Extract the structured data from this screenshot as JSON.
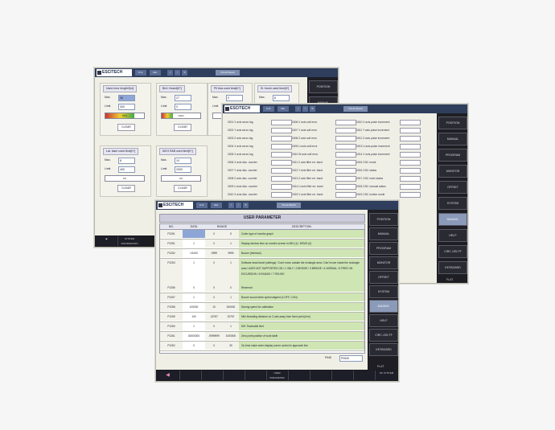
{
  "brand": "ESCITECH",
  "toolbar_tabs": [
    "U.S.",
    "Rel."
  ],
  "toolbar_wide_label": "Check Board",
  "toolbar_icons": [
    "info-icon",
    "alarm-icon",
    "edit-icon"
  ],
  "window_back": {
    "groups": [
      {
        "title": "Used error lengthX[m]",
        "max_label": "Max.",
        "max_value": "36",
        "limit_label": "Limit",
        "limit_value": "300",
        "progress_percent": 75,
        "progress_text": "75%",
        "button": "CLEAR"
      },
      {
        "title": "Bin1 Hosed[K*]",
        "max_label": "Max.",
        "max_value": "27",
        "limit_label": "Limit",
        "limit_value": "0",
        "progress_percent": 30,
        "progress_text": "100%",
        "button": "CLEAR"
      },
      {
        "title": "Pil bios used time[h*]",
        "max_label": "Max.",
        "max_value": "0",
        "limit_label": "Limit",
        "limit_value": "",
        "progress_percent": 0,
        "progress_text": "",
        "button": "CLEAR"
      },
      {
        "title": "Sl. brush used time[h*]",
        "max_label": "Max.",
        "max_value": "8",
        "limit_label": "Limit",
        "limit_value": "",
        "progress_percent": 0,
        "progress_text": "",
        "button": ""
      },
      {
        "title": "Lat. laser used time[h*]",
        "max_label": "Max.",
        "max_value": "8",
        "limit_label": "Limit",
        "limit_value": "400",
        "progress_percent": 0,
        "progress_text": "0%",
        "button": "CLEAR"
      },
      {
        "title": "MCH R&B used time[h*]",
        "max_label": "Max.",
        "max_value": "10",
        "limit_label": "Limit",
        "limit_value": "2000",
        "progress_percent": 0,
        "progress_text": "0%",
        "button": "CLEAR"
      }
    ],
    "sidebar": [
      "POSITION",
      "MANUAL"
    ],
    "bottom_slots": [
      "",
      "SYSTEM INFORMATION",
      "",
      "",
      "",
      "",
      "",
      "",
      ""
    ]
  },
  "window_mid": {
    "diag_columns": [
      [
        "0001 X axis servo lag",
        "0002 Y axis servo lag",
        "0003 Z axis servo lag",
        "0004 X axis servo lag",
        "0005 X axis servo lag",
        "0006 X axis disc. counter",
        "0007 Y axis disc. counter",
        "0008 Z axis disc. counter",
        "0009 U axis disc. counter",
        "0010 X axis disc. counter"
      ],
      [
        "0006 X axis soft error",
        "0007 Y axis soft error",
        "0008 Z axis soft error",
        "0009 U axis soft error",
        "0010 W axis soft error",
        "0011 X axis filter err. band",
        "0012 Y axis filter err. band",
        "0013 Z axis filter err. band",
        "0014 U axis filter err. band",
        "0015 V axis filter err. band"
      ],
      [
        "0010 X axis pulse increment",
        "0011 Y axis pulse increment",
        "0012 Z axis pulse increment",
        "0013 U axis pulse increment",
        "0014 V axis pulse increment",
        "0015 CNC mode",
        "0016 CNC status",
        "0017 CNC main status",
        "0018 CNC manual status",
        "0019 CNC motion mode"
      ]
    ],
    "sidebar": [
      "POSITION",
      "MANUAL",
      "PROGRAM",
      "MONITOR",
      "OFFSET",
      "SYSTEM",
      "DIAGNO.",
      "HELP",
      "CIRC LEN TF",
      "KEYBOARD"
    ],
    "sidebar_active_index": 6,
    "bottom_extra": "FLAT"
  },
  "window_front": {
    "title": "USER PARAMETER",
    "columns": [
      "NO.",
      "DATA",
      "RANGE",
      "",
      "DESCRIPTION"
    ],
    "rows": [
      {
        "no": "P1251",
        "data": "",
        "min": "0",
        "max": "5",
        "desc": "Cutter type of monitor graph",
        "selected": true
      },
      {
        "no": "P1251",
        "data": "1",
        "min": "0",
        "max": "1",
        "desc": "Display window time on monitor screen in MDI (1) / DEMO (0)"
      },
      {
        "no": "P1252",
        "data": "1/1000",
        "min": "-9999",
        "max": "9999",
        "desc": "Buzzer (interlock)"
      },
      {
        "no": "P1253",
        "data": "1",
        "min": "0",
        "max": "1",
        "desc": "Software dead travel (settings) / Can't move outside the rectangle area / Can't move inside the rectangle area / AXES NOT SUPPORTED ON / 1 ONLY / 2 BRIDGE / 3 BRIDGE / 4 NORMAL / 5 FREE ON EXCURSION / 6 RADIUS / 7 ROUGH",
        "tall": true
      },
      {
        "no": "P1256",
        "data": "0",
        "min": "0",
        "max": "0",
        "desc": "Reserved"
      },
      {
        "no": "P1257",
        "data": "1",
        "min": "0",
        "max": "1",
        "desc": "Buzzer sound when speed aligned (1:OFF, 1:ON)"
      },
      {
        "no": "P1258",
        "data": "100000",
        "min": "10",
        "max": "300000",
        "desc": "Moving speed for calibration"
      },
      {
        "no": "P1259",
        "data": "100",
        "min": "-32767",
        "max": "32767",
        "desc": "Mini threading distance on Z axis away from fixed point [mm]"
      },
      {
        "no": "P1260",
        "data": "1",
        "min": "0",
        "max": "1",
        "desc": "MH: Teachable limit"
      },
      {
        "no": "P1261",
        "data": "30000000",
        "min": "-9999999",
        "max": "1000000",
        "desc": "Zero point position of work table"
      },
      {
        "no": "P1262",
        "data": "0",
        "min": "0",
        "max": "30",
        "desc": "On-time value when display corner control in approach line"
      }
    ],
    "find_label": "FIND",
    "find_value": "P0000",
    "sidebar": [
      "POSITION",
      "MANUAL",
      "PROGRAM",
      "MONITOR",
      "OFFSET",
      "SYSTEM",
      "DIAGNO.",
      "HELP",
      "CIRC LEN TF",
      "KEYBOARD"
    ],
    "sidebar_active_index": 6,
    "bottom_slots": [
      "",
      "",
      "",
      "",
      "",
      "USER PARAMETER",
      "",
      "",
      "",
      ""
    ],
    "bottom_extra": "FLAT",
    "bottom_right": "NC SYSTEM"
  },
  "colors": {
    "header": "#2f3e5c",
    "sidebar": "#1e1e24",
    "active": "#8a9ab8",
    "desc_bg": "#cfe5b4",
    "selected": "#8ea6d6"
  }
}
